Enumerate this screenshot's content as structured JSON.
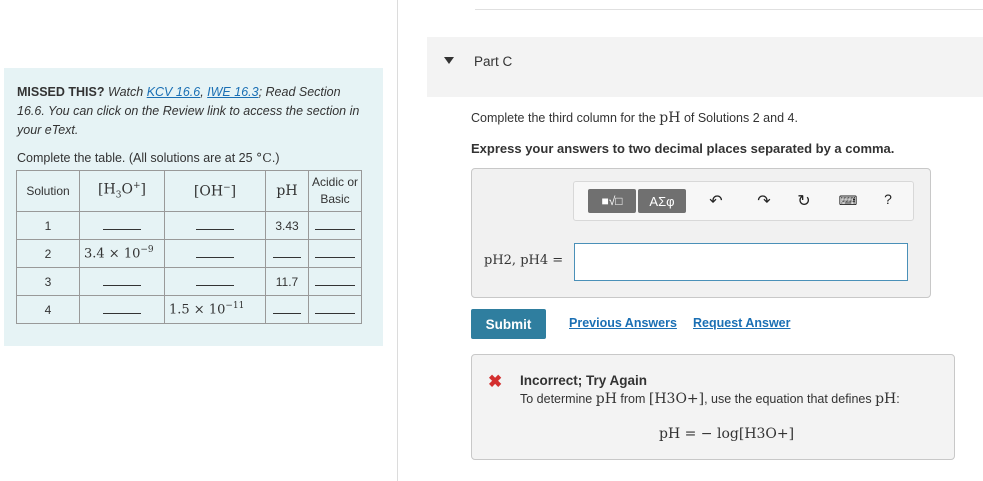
{
  "left_panel": {
    "missed_prefix": "MISSED THIS?",
    "watch": "Watch",
    "kcv_link": "KCV 16.6",
    "iwe_link": "IWE 16.3",
    "read_text": "; Read Section 16.6. You can click on the Review link to access the section in your eText.",
    "instruction_prefix": "Complete the table. (All solutions are at 25 ",
    "instruction_temp": "°C",
    "instruction_suffix": ".)"
  },
  "table": {
    "headers": [
      "Solution",
      "[H3O+]",
      "[OH−]",
      "pH",
      "Acidic or Basic"
    ],
    "rows": [
      {
        "solution": "1",
        "h3o": "",
        "oh": "",
        "ph": "3.43",
        "acidic_basic": ""
      },
      {
        "solution": "2",
        "h3o_coef": "3.4 × 10",
        "h3o_exp": "−9",
        "oh": "",
        "ph": "",
        "acidic_basic": ""
      },
      {
        "solution": "3",
        "h3o": "",
        "oh": "",
        "ph": "11.7",
        "acidic_basic": ""
      },
      {
        "solution": "4",
        "h3o": "",
        "oh_coef": "1.5 × 10",
        "oh_exp": "−11",
        "ph": "",
        "acidic_basic": ""
      }
    ]
  },
  "part": {
    "title": "Part C",
    "question_prefix": "Complete the third column for the ",
    "question_ph": "pH",
    "question_suffix": " of Solutions 2 and 4.",
    "instruction": "Express your answers to two decimal places separated by a comma.",
    "answer_label": "pH2, pH4 =",
    "answer_value": ""
  },
  "toolbar": {
    "template_label": "■√□",
    "greek_label": "ΑΣφ",
    "help_label": "?"
  },
  "actions": {
    "submit": "Submit",
    "previous_answers": "Previous Answers",
    "request_answer": "Request Answer"
  },
  "feedback": {
    "title": "Incorrect; Try Again",
    "text_prefix": "To determine ",
    "text_ph": "pH",
    "text_mid": " from ",
    "text_h3o": "[H3O+]",
    "text_suffix": ", use the equation that defines ",
    "text_ph2": "pH",
    "text_end": ":",
    "equation": "pH = − log[H3O+]"
  },
  "icons": {
    "undo": "undo-icon",
    "redo": "redo-icon",
    "reset": "reset-icon",
    "keyboard": "keyboard-icon",
    "incorrect": "x-icon",
    "collapse": "triangle-down-icon"
  },
  "colors": {
    "panel_bg": "#e6f3f5",
    "link": "#1a6fb4",
    "submit_bg": "#2f7e9f",
    "error": "#d32f2f"
  }
}
